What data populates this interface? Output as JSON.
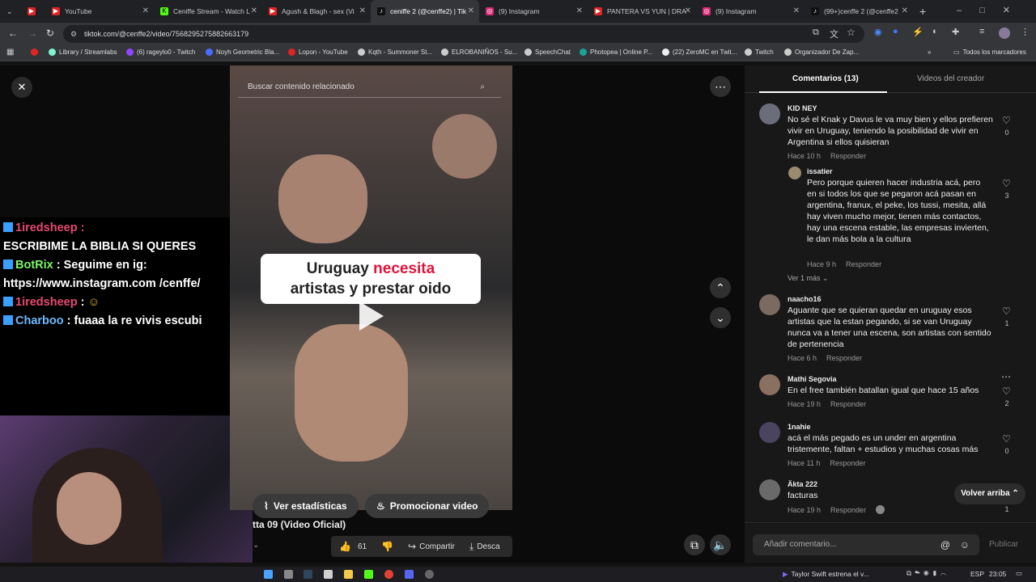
{
  "browser": {
    "tabs": [
      {
        "label": "YouTube",
        "color": "#e02424"
      },
      {
        "label": "Ceniffe Stream - Watch L",
        "color": "#53fc18"
      },
      {
        "label": "Agush & Blagh - sex (Vi",
        "color": "#e02424"
      },
      {
        "label": "ceniffe 2 (@cenffe2) | Tik",
        "color": "#111111"
      },
      {
        "label": "(9) Instagram",
        "color": "#d62976"
      },
      {
        "label": "PANTERA VS YUN | DRA",
        "color": "#e02424"
      },
      {
        "label": "(9) Instagram",
        "color": "#d62976"
      },
      {
        "label": "(99+)cenffe 2 (@cenffe2",
        "color": "#111111"
      }
    ],
    "url": "tiktok.com/@cenffe2/video/7568295275882663179",
    "bookmarks": [
      "Library / Streamlabs",
      "(6) rageylo0 - Twitch",
      "Noyh Geometric Bla...",
      "Lopon - YouTube",
      "Kqth - Summoner St...",
      "ELROBANIÑOS - Su...",
      "SpeechChat",
      "Photopea | Online P...",
      "(22) ZeroMC en Twit...",
      "Twitch",
      "Organizador De Zap..."
    ],
    "all_bookmarks": "Todos los marcadores"
  },
  "video": {
    "search_placeholder": "Buscar contenido relacionado",
    "caption_line1_a": "Uruguay ",
    "caption_line1_b": "necesita",
    "caption_line2": "artistas y prestar oido",
    "stats_button": "Ver estadísticas",
    "promote_button": "Promocionar video",
    "title": "tta 09 (Video Oficial)",
    "likes": "61",
    "share": "Compartir",
    "download": "Desca"
  },
  "chat": {
    "line1_user": "1iredsheep :",
    "line2": "ESCRIBIME LA BIBLIA SI QUERES",
    "bot_user": "BotRix",
    "bot_msg": ": Seguime en ig: https://www.instagram.com /cenffe/",
    "line3_user": "1iredsheep",
    "line3_msg": ":",
    "line4_user": "Charboo",
    "line4_msg": ": fuaaa la re vivis escubi"
  },
  "comments_panel": {
    "tab_comments": "Comentarios (13)",
    "tab_videos": "Videos del creador",
    "comments": [
      {
        "name": "KID NEY",
        "text": "No sé el Knak y Davus le va muy bien y ellos prefieren vivir en Uruguay, teniendo la posibilidad de vivir en Argentina si ellos quisieran",
        "time": "Hace 10 h",
        "reply": "Responder",
        "likes": "0"
      },
      {
        "name": "issatier",
        "text": "Pero porque quieren hacer industria acá, pero en si todos los que se pegaron acá pasan en argentina, franux, el peke, los tussi, mesita, allá hay viven mucho mejor, tienen más contactos, hay una escena estable, las empresas invierten, le dan más bola a la cultura",
        "time": "Hace 9 h",
        "reply": "Responder",
        "likes": "3"
      },
      {
        "name": "naacho16",
        "text": "Aguante que se quieran quedar en uruguay esos artistas que la estan pegando, si se van Uruguay nunca va a tener una escena, son artistas con sentido de pertenencia",
        "time": "Hace 6 h",
        "reply": "Responder",
        "likes": "1"
      },
      {
        "name": "Mathi Segovia",
        "text": "En el free también batallan igual que hace 15 años",
        "time": "Hace 19 h",
        "reply": "Responder",
        "likes": "2"
      },
      {
        "name": "1nahie",
        "text": "acá el más pegado es un under en argentina tristemente, faltan + estudios y muchas cosas más",
        "time": "Hace 11 h",
        "reply": "Responder",
        "likes": "0"
      },
      {
        "name": "Äkta 222",
        "text": "facturas",
        "time": "Hace 19 h",
        "reply": "Responder",
        "likes": "1"
      }
    ],
    "view_more": "Ver 1 más",
    "back_to_top": "Volver arriba",
    "add_comment_placeholder": "Añadir comentario...",
    "publish": "Publicar"
  },
  "taskbar": {
    "news": "Taylor Swift estrena el v...",
    "lang": "ESP",
    "time": "23:05"
  }
}
